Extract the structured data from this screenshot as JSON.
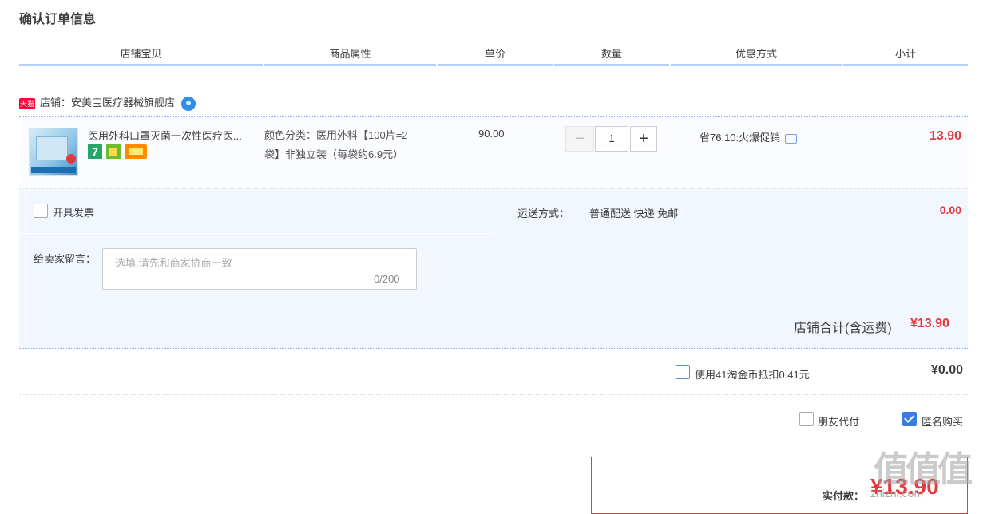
{
  "title": "确认订单信息",
  "columns": [
    "店铺宝贝",
    "商品属性",
    "单价",
    "数量",
    "优惠方式",
    "小计"
  ],
  "shop": {
    "badge": "天猫",
    "label": "店铺：安美宝医疗器械旗舰店"
  },
  "item": {
    "name": "医用外科口罩灭菌一次性医疗医...",
    "badge_7": "7",
    "attr_line1": "颜色分类：医用外科【100片=2",
    "attr_line2": "袋】非独立装（每袋约6.9元）",
    "price": "90.00",
    "minus": "−",
    "qty": "1",
    "plus": "+",
    "promo": "省76.10:火爆促销",
    "subtotal": "13.90"
  },
  "invoice_label": "开具发票",
  "message": {
    "label": "给卖家留言：",
    "placeholder": "选填,请先和商家协商一致",
    "count": "0/200"
  },
  "shipping": {
    "label": "运送方式：",
    "value": "普通配送 快递 免邮",
    "fee": "0.00"
  },
  "shop_total": {
    "label": "店铺合计(含运费)",
    "value": "¥13.90"
  },
  "coins": {
    "label": "使用41淘金币抵扣0.41元",
    "value": "¥0.00"
  },
  "options": {
    "friend_pay": "朋友代付",
    "anonymous": "匿名购买"
  },
  "payment": {
    "label": "实付款：",
    "value": "¥13.90"
  },
  "watermark": {
    "glyphs": "值值值",
    "url": "zhizhi.com"
  },
  "colors": {
    "accent_red": "#e4393c",
    "header_blue": "#b2d1ff",
    "panel_bg": "#f2f7ff"
  }
}
